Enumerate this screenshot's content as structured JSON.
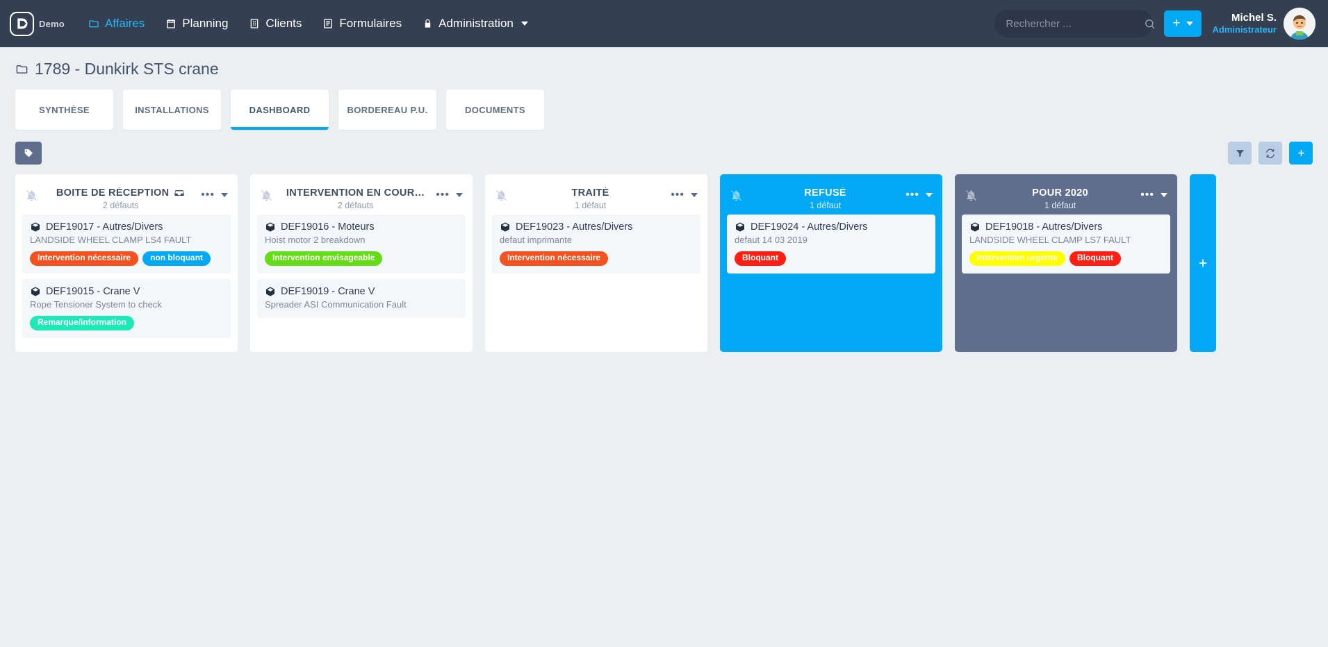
{
  "navbar": {
    "brand_label": "Demo",
    "logo_icon": "app-logo-icon",
    "links": [
      {
        "label": "Affaires",
        "icon": "folder-icon",
        "active": true,
        "caret": false
      },
      {
        "label": "Planning",
        "icon": "calendar-icon",
        "active": false,
        "caret": false
      },
      {
        "label": "Clients",
        "icon": "building-icon",
        "active": false,
        "caret": false
      },
      {
        "label": "Formulaires",
        "icon": "form-icon",
        "active": false,
        "caret": false
      },
      {
        "label": "Administration",
        "icon": "lock-icon",
        "active": false,
        "caret": true
      }
    ],
    "search": {
      "placeholder": "Rechercher ...",
      "value": "",
      "icon": "search-icon"
    },
    "add_button": {
      "icon": "plus-icon",
      "caret_icon": "chevron-down-icon"
    },
    "user": {
      "name": "Michel S.",
      "role": "Administrateur",
      "avatar_icon": "avatar-icon"
    }
  },
  "page": {
    "title": "1789 - Dunkirk STS crane",
    "title_icon": "folder-icon"
  },
  "tabs": [
    {
      "label": "SYNTHÈSE",
      "active": false
    },
    {
      "label": "INSTALLATIONS",
      "active": false
    },
    {
      "label": "DASHBOARD",
      "active": true
    },
    {
      "label": "BORDEREAU P.U.",
      "active": false
    },
    {
      "label": "DOCUMENTS",
      "active": false
    }
  ],
  "toolbar": {
    "tag_button_icon": "tag-icon",
    "filter_button_icon": "filter-icon",
    "refresh_button_icon": "refresh-icon",
    "add_button_icon": "plus-icon"
  },
  "board": {
    "add_column_label": "+",
    "columns": [
      {
        "title": "BOITE DE RÉCEPTION",
        "title_icon": "inbox-icon",
        "count_label": "2 défauts",
        "style": "white",
        "bell_icon": "bell-slash-icon",
        "menu_icon": "ellipsis-icon",
        "caret_icon": "chevron-down-icon",
        "cards": [
          {
            "code": "DEF19017",
            "category": "Autres/Divers",
            "title": "DEF19017 - Autres/Divers",
            "desc": "LANDSIDE WHEEL CLAMP LS4 FAULT",
            "icon": "box-icon",
            "badges": [
              {
                "label": "Intervention nécessaire",
                "color": "#f4511e"
              },
              {
                "label": "non bloquant",
                "color": "#03a9f4"
              }
            ]
          },
          {
            "code": "DEF19015",
            "category": "Crane V",
            "title": "DEF19015 - Crane V",
            "desc": "Rope Tensioner System to check",
            "icon": "box-icon",
            "badges": [
              {
                "label": "Remarque/information",
                "color": "#1de9b6"
              }
            ]
          }
        ]
      },
      {
        "title": "INTERVENTION EN COUR…",
        "title_icon": "",
        "count_label": "2 défauts",
        "style": "white",
        "bell_icon": "bell-slash-icon",
        "menu_icon": "ellipsis-icon",
        "caret_icon": "chevron-down-icon",
        "cards": [
          {
            "code": "DEF19016",
            "category": "Moteurs",
            "title": "DEF19016 - Moteurs",
            "desc": "Hoist motor 2 breakdown",
            "icon": "box-icon",
            "badges": [
              {
                "label": "Intervention envisageable",
                "color": "#64dd17"
              }
            ]
          },
          {
            "code": "DEF19019",
            "category": "Crane V",
            "title": "DEF19019 - Crane V",
            "desc": "Spreader ASI Communication Fault",
            "icon": "box-icon",
            "badges": []
          }
        ]
      },
      {
        "title": "TRAITÉ",
        "title_icon": "",
        "count_label": "1 défaut",
        "style": "white",
        "bell_icon": "bell-slash-icon",
        "menu_icon": "ellipsis-icon",
        "caret_icon": "chevron-down-icon",
        "cards": [
          {
            "code": "DEF19023",
            "category": "Autres/Divers",
            "title": "DEF19023 - Autres/Divers",
            "desc": "defaut imprimante",
            "icon": "box-icon",
            "badges": [
              {
                "label": "Intervention nécessaire",
                "color": "#f4511e"
              }
            ]
          }
        ]
      },
      {
        "title": "REFUSÉ",
        "title_icon": "",
        "count_label": "1 défaut",
        "style": "blue",
        "bell_icon": "bell-slash-icon",
        "menu_icon": "ellipsis-icon",
        "caret_icon": "chevron-down-icon",
        "cards": [
          {
            "code": "DEF19024",
            "category": "Autres/Divers",
            "title": "DEF19024 - Autres/Divers",
            "desc": "defaut 14 03 2019",
            "icon": "box-icon",
            "badges": [
              {
                "label": "Bloquant",
                "color": "#ff1e12"
              }
            ]
          }
        ]
      },
      {
        "title": "POUR 2020",
        "title_icon": "",
        "count_label": "1 défaut",
        "style": "slate",
        "bell_icon": "bell-slash-icon",
        "menu_icon": "ellipsis-icon",
        "caret_icon": "chevron-down-icon",
        "cards": [
          {
            "code": "DEF19018",
            "category": "Autres/Divers",
            "title": "DEF19018 - Autres/Divers",
            "desc": "LANDSIDE WHEEL CLAMP LS7 FAULT",
            "icon": "box-icon",
            "badges": [
              {
                "label": "Intervention urgente",
                "color": "#ffff00",
                "text_color": "#ffffff"
              },
              {
                "label": "Bloquant",
                "color": "#ff1e12"
              }
            ]
          }
        ]
      }
    ]
  },
  "colors": {
    "navbar_bg": "#343f52",
    "accent": "#03a9f4",
    "page_bg": "#eceff1",
    "slate": "#5e6e8c"
  }
}
